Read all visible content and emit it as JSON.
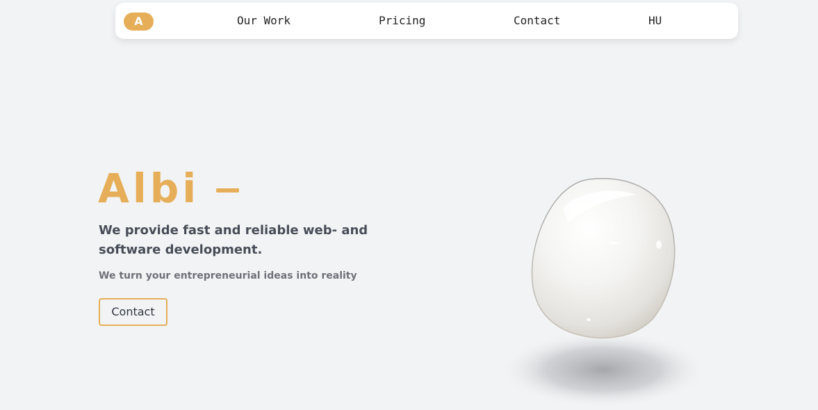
{
  "nav": {
    "logo_letter": "A",
    "items": [
      {
        "label": "Our Work"
      },
      {
        "label": "Pricing"
      },
      {
        "label": "Contact"
      },
      {
        "label": "HU"
      }
    ]
  },
  "hero": {
    "title": "Albi",
    "subtitle": "We provide fast and reliable web- and software development.",
    "tagline": "We turn your entrepreneurial ideas into reality",
    "button_label": "Contact"
  },
  "colors": {
    "accent": "#e6ae58",
    "background": "#f2f3f5",
    "heading_text": "#474d57",
    "muted_text": "#6d7178"
  },
  "icons": {
    "hero_visual": "glossy-blob-image"
  }
}
